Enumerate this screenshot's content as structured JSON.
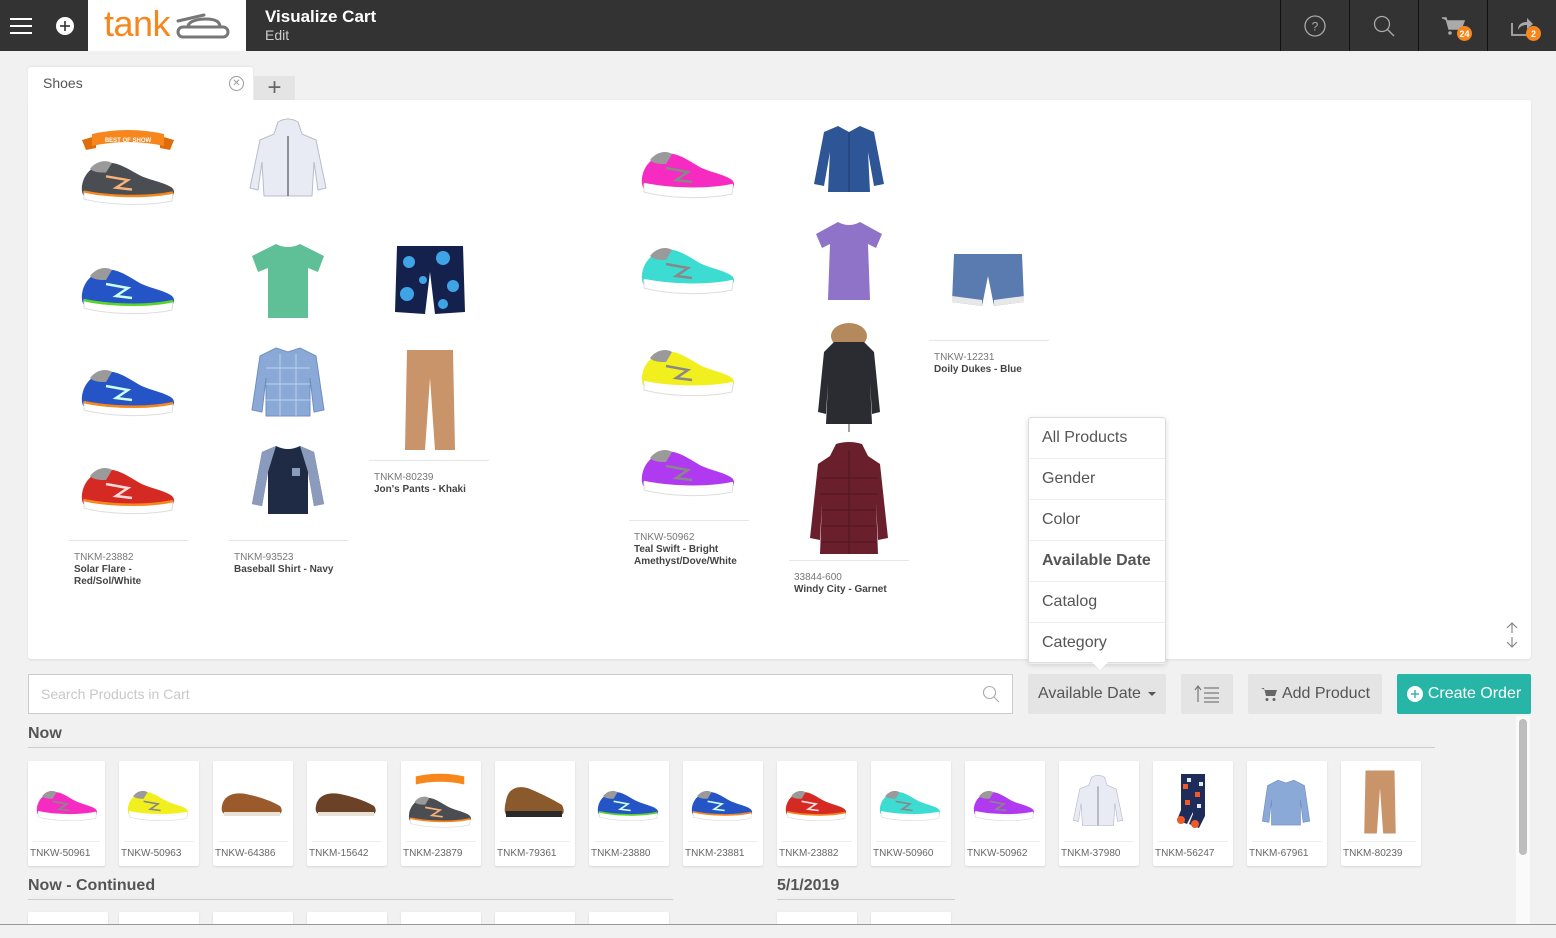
{
  "header": {
    "menu_icon": "hamburger-icon",
    "add_icon": "plus-circle-icon",
    "logo_text": "tank",
    "title": "Visualize Cart",
    "subtitle": "Edit",
    "right_icons": [
      {
        "name": "help-icon"
      },
      {
        "name": "search-icon"
      },
      {
        "name": "cart-icon",
        "badge": "24"
      },
      {
        "name": "share-icon",
        "badge": "2"
      }
    ],
    "accent_color": "#f7861c"
  },
  "tabs": [
    {
      "label": "Shoes",
      "active": true
    }
  ],
  "add_tab_label": "+",
  "canvas": {
    "products": [
      {
        "sku": "TNKM-23882",
        "name": "Solar Flare - Red/Sol/White"
      },
      {
        "sku": "TNKM-93523",
        "name": "Baseball Shirt - Navy"
      },
      {
        "sku": "TNKM-80239",
        "name": "Jon's Pants - Khaki"
      },
      {
        "sku": "TNKW-50962",
        "name": "Teal Swift - Bright Amethyst/Dove/White"
      },
      {
        "sku": "33844-600",
        "name": "Windy City - Garnet"
      },
      {
        "sku": "TNKW-12231",
        "name": "Doily Dukes - Blue"
      }
    ],
    "badge_text": "BEST OF SHOW"
  },
  "sort_menu": {
    "options": [
      "All Products",
      "Gender",
      "Color",
      "Available Date",
      "Catalog",
      "Category"
    ],
    "selected": "Available Date"
  },
  "toolbar": {
    "search_placeholder": "Search Products in Cart",
    "sort_by_label": "Available Date",
    "add_product_label": "Add Product",
    "create_order_label": "Create Order",
    "create_order_color": "#26b5a7"
  },
  "sections": [
    {
      "title": "Now",
      "items": [
        "TNKW-50961",
        "TNKW-50963",
        "TNKW-64386",
        "TNKM-15642",
        "TNKM-23879",
        "TNKM-79361",
        "TNKM-23880",
        "TNKM-23881",
        "TNKM-23882",
        "TNKW-50960",
        "TNKW-50962",
        "TNKM-37980",
        "TNKM-56247",
        "TNKM-67961",
        "TNKM-80239"
      ]
    },
    {
      "title": "Now - Continued"
    },
    {
      "title": "5/1/2019"
    }
  ]
}
